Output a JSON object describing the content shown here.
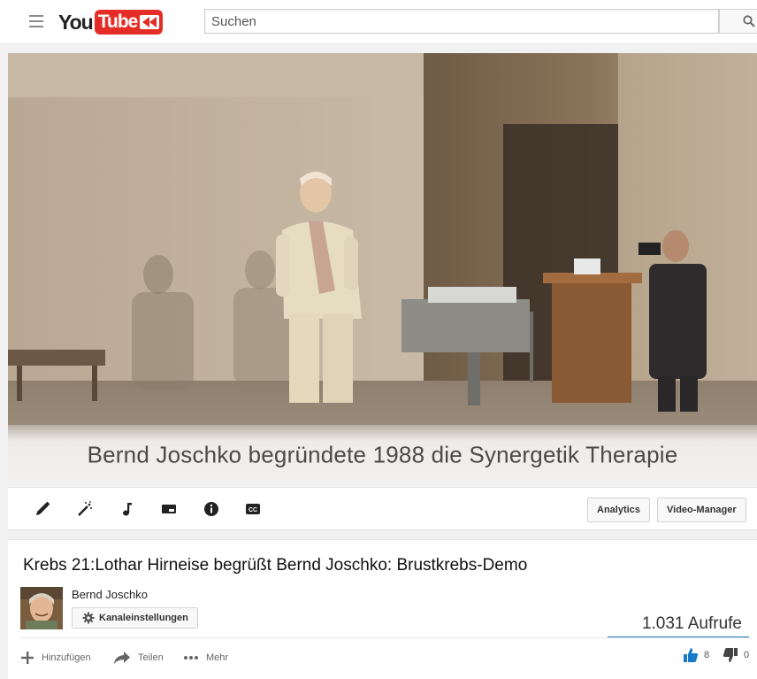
{
  "masthead": {
    "menu_icon": "hamburger-menu-icon",
    "logo_text_you": "You",
    "logo_text_tube": "Tube",
    "search_placeholder": "Suchen",
    "search_icon": "search-icon"
  },
  "player": {
    "caption": "Bernd Joschko begründete 1988 die Synergetik Therapie"
  },
  "toolbar": {
    "tools": [
      {
        "name": "pencil-icon"
      },
      {
        "name": "magic-wand-icon"
      },
      {
        "name": "music-note-icon"
      },
      {
        "name": "annotations-icon"
      },
      {
        "name": "info-icon"
      },
      {
        "name": "closed-captions-icon"
      }
    ],
    "analytics_label": "Analytics",
    "video_manager_label": "Video-Manager"
  },
  "video": {
    "title": "Krebs 21:Lothar Hirneise begrüßt Bernd Joschko: Brustkrebs-Demo",
    "owner": "Bernd Joschko",
    "channel_settings_label": "Kanaleinstellungen",
    "views": "1.031 Aufrufe",
    "actions": {
      "add_label": "Hinzufügen",
      "share_label": "Teilen",
      "more_label": "Mehr"
    },
    "likes": "8",
    "dislikes": "0"
  },
  "colors": {
    "brand_red": "#e52d27",
    "accent_blue": "#167ac6"
  }
}
